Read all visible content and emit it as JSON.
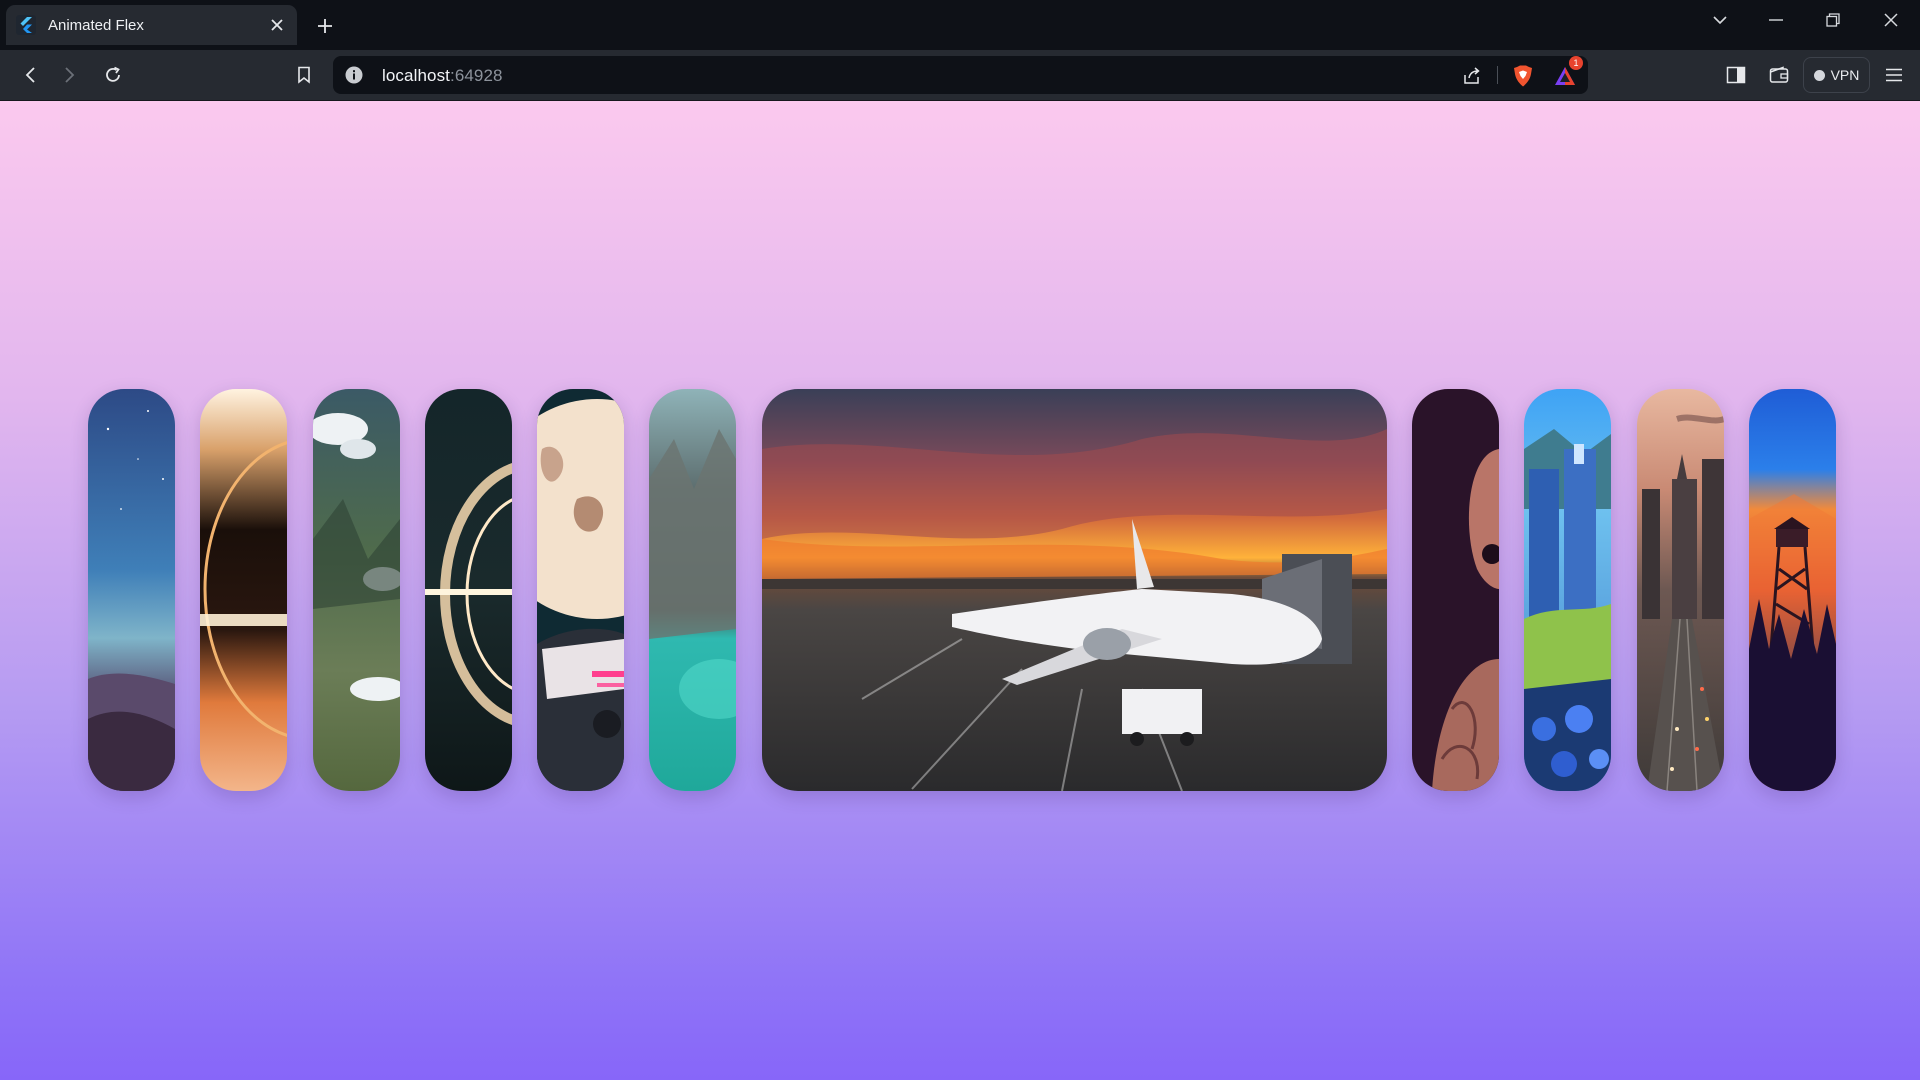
{
  "browser": {
    "tab_title": "Animated Flex",
    "url_host": "localhost",
    "url_port": ":64928",
    "vpn_label": "VPN",
    "notification_count": "1",
    "accent": "#e8432e"
  },
  "page": {
    "background_top": "#fbc9ee",
    "background_bottom": "#8766f9",
    "cards": [
      {
        "name": "card-night-sky-hills",
        "expanded": false
      },
      {
        "name": "card-black-hole-ring",
        "expanded": false
      },
      {
        "name": "card-aerial-mountains-clouds",
        "expanded": false
      },
      {
        "name": "card-glowing-ring",
        "expanded": false
      },
      {
        "name": "card-anime-moon-car",
        "expanded": false
      },
      {
        "name": "card-mountain-lake",
        "expanded": false
      },
      {
        "name": "card-airplane-sunset",
        "expanded": true
      },
      {
        "name": "card-anime-creature",
        "expanded": false
      },
      {
        "name": "card-anime-city-flowers",
        "expanded": false
      },
      {
        "name": "card-city-highway",
        "expanded": false
      },
      {
        "name": "card-fire-tower-sunset",
        "expanded": false
      }
    ]
  }
}
